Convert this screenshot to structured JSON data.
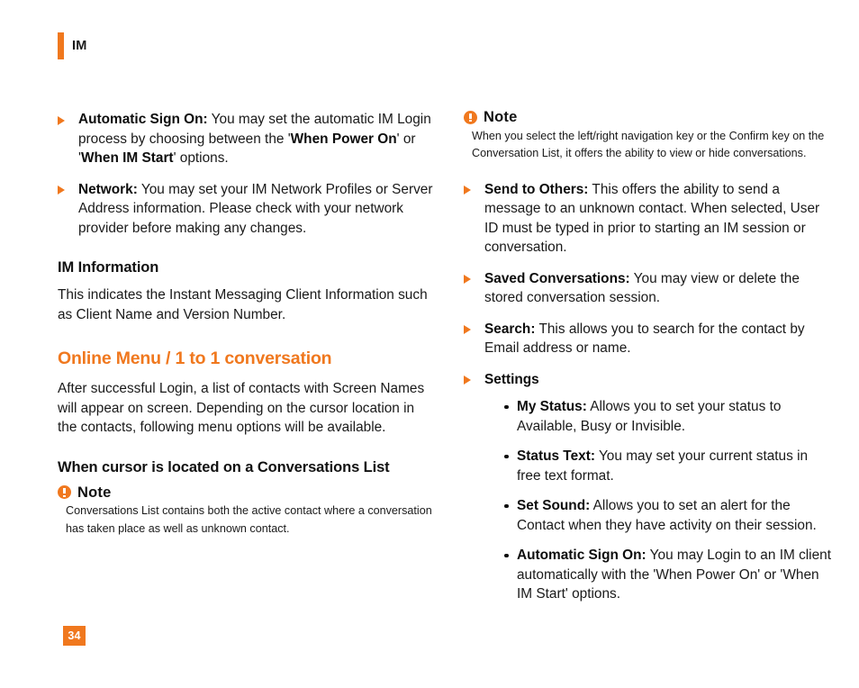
{
  "colors": {
    "accent": "#F0781E",
    "text": "#1a1a1a",
    "page_background": "#ffffff",
    "page_number_text": "#ffffff"
  },
  "running_head": {
    "title": "IM",
    "bar_icon": "orange-bar-icon"
  },
  "left_column": {
    "bullets": [
      {
        "marker": "triangle-bullet-icon",
        "label": "Automatic Sign On:",
        "text_parts": [
          {
            "type": "plain",
            "text": " You may set the automatic IM Login process by choosing between the '"
          },
          {
            "type": "bold",
            "text": "When Power On"
          },
          {
            "type": "plain",
            "text": "' or '"
          },
          {
            "type": "bold",
            "text": "When IM Start"
          },
          {
            "type": "plain",
            "text": "' options."
          }
        ]
      },
      {
        "marker": "triangle-bullet-icon",
        "label": "Network:",
        "text_parts": [
          {
            "type": "plain",
            "text": " You may set your IM Network Profiles or Server Address information. Please check with your network provider before making any changes."
          }
        ]
      }
    ],
    "im_information_heading": "IM Information",
    "im_information_body": "This indicates the Instant Messaging Client Information such as Client Name and Version Number.",
    "online_menu_heading": "Online Menu / 1 to 1 conversation",
    "online_menu_body": "After successful Login, a list of contacts with Screen Names will appear on screen. Depending on the cursor location in the contacts, following menu options will be available.",
    "cursor_heading": "When cursor is located on a Conversations List",
    "note": {
      "icon": "note-exclamation-icon",
      "title": "Note",
      "body": "Conversations List contains both the active contact where a conversation has taken place as well as unknown contact."
    }
  },
  "right_column": {
    "note": {
      "icon": "note-exclamation-icon",
      "title": "Note",
      "body": "When you select the left/right navigation key or the Confirm key on the Conversation List, it offers the ability to view or hide conversations."
    },
    "bullets": [
      {
        "marker": "triangle-bullet-icon",
        "label": "Send to Others:",
        "text": " This offers the ability to send a message to an unknown contact. When selected, User ID must be typed in prior to starting an IM session or conversation."
      },
      {
        "marker": "triangle-bullet-icon",
        "label": "Saved Conversations:",
        "text": " You may view or delete the stored conversation session."
      },
      {
        "marker": "triangle-bullet-icon",
        "label": "Search:",
        "text": " This allows you to search for the contact by Email address or name."
      }
    ],
    "settings": {
      "marker": "triangle-bullet-icon",
      "label": "Settings",
      "sub_bullets": [
        {
          "marker": "dot-bullet-icon",
          "label": "My Status:",
          "text": " Allows you to set your status to Available, Busy or Invisible."
        },
        {
          "marker": "dot-bullet-icon",
          "label": "Status Text:",
          "text": " You may set your current status in free text format."
        },
        {
          "marker": "dot-bullet-icon",
          "label": "Set Sound:",
          "text": " Allows you to set an alert for the Contact when they have activity on their session."
        },
        {
          "marker": "dot-bullet-icon",
          "label": "Automatic Sign On:",
          "text": " You may Login to an IM client automatically with the 'When Power On' or 'When IM Start' options."
        }
      ]
    }
  },
  "page_number": "34"
}
